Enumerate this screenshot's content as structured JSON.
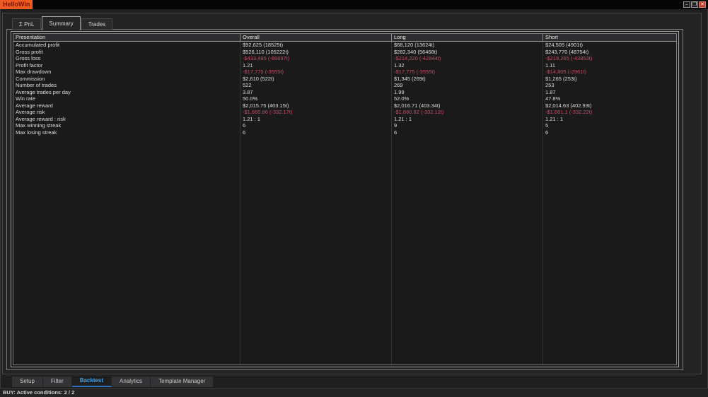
{
  "window": {
    "title": "HelloWin",
    "controls": {
      "minimize": "–",
      "restore": "❐",
      "close": "✕"
    }
  },
  "colors": {
    "title_chip": "#ee5a22",
    "negative_value": "#d04863",
    "active_bottom_tab_text": "#41a0e6",
    "active_bottom_tab_underline": "#2f6fc0"
  },
  "top_tabs": [
    {
      "label": "Σ PnL",
      "active": false
    },
    {
      "label": "Summary",
      "active": true
    },
    {
      "label": "Trades",
      "active": false
    }
  ],
  "table": {
    "columns": [
      "Presentation",
      "Overall",
      "Long",
      "Short"
    ],
    "rows": [
      {
        "label": "Accumulated profit",
        "overall": "$92,625 (18525t)",
        "long": "$68,120 (13624t)",
        "short": "$24,505 (4901t)",
        "negative": false
      },
      {
        "label": "Gross profit",
        "overall": "$526,110 (105222t)",
        "long": "$282,340 (56468t)",
        "short": "$243,770 (48754t)",
        "negative": false
      },
      {
        "label": "Gross loss",
        "overall": "-$433,485 (-86697t)",
        "long": "-$214,220 (-42844t)",
        "short": "-$219,265 (-43853t)",
        "negative": true
      },
      {
        "label": "Profit factor",
        "overall": "1.21",
        "long": "1.32",
        "short": "1.11",
        "negative": false
      },
      {
        "label": "Max drawdown",
        "overall": "-$17,775 (-3555t)",
        "long": "-$17,775 (-3555t)",
        "short": "-$14,805 (-2961t)",
        "negative": true
      },
      {
        "label": "Commission",
        "overall": "$2,610 (522t)",
        "long": "$1,345 (269t)",
        "short": "$1,265 (253t)",
        "negative": false
      },
      {
        "label": "Number of trades",
        "overall": "522",
        "long": "269",
        "short": "253",
        "negative": false
      },
      {
        "label": "Average trades per day",
        "overall": "3.87",
        "long": "1.99",
        "short": "1.87",
        "negative": false
      },
      {
        "label": "Win rate",
        "overall": "50.0%",
        "long": "52.0%",
        "short": "47.8%",
        "negative": false
      },
      {
        "label": "Average reward",
        "overall": "$2,015.75 (403.15t)",
        "long": "$2,016.71 (403.34t)",
        "short": "$2,014.63 (402.93t)",
        "negative": false
      },
      {
        "label": "Average risk",
        "overall": "-$1,660.86 (-332.17t)",
        "long": "-$1,660.62 (-332.12t)",
        "short": "-$1,661.1 (-332.22t)",
        "negative": true
      },
      {
        "label": "Average reward : risk",
        "overall": "1.21 : 1",
        "long": "1.21 : 1",
        "short": "1.21 : 1",
        "negative": false
      },
      {
        "label": "Max winning streak",
        "overall": "6",
        "long": "9",
        "short": "5",
        "negative": false
      },
      {
        "label": "Max losing streak",
        "overall": "6",
        "long": "6",
        "short": "6",
        "negative": false
      }
    ]
  },
  "bottom_tabs": [
    {
      "label": "Setup",
      "active": false
    },
    {
      "label": "Filter",
      "active": false
    },
    {
      "label": "Backtest",
      "active": true
    },
    {
      "label": "Analytics",
      "active": false
    },
    {
      "label": "Template Manager",
      "active": false
    }
  ],
  "status_bar": {
    "text": "BUY:  Active conditions: 2 / 2"
  }
}
